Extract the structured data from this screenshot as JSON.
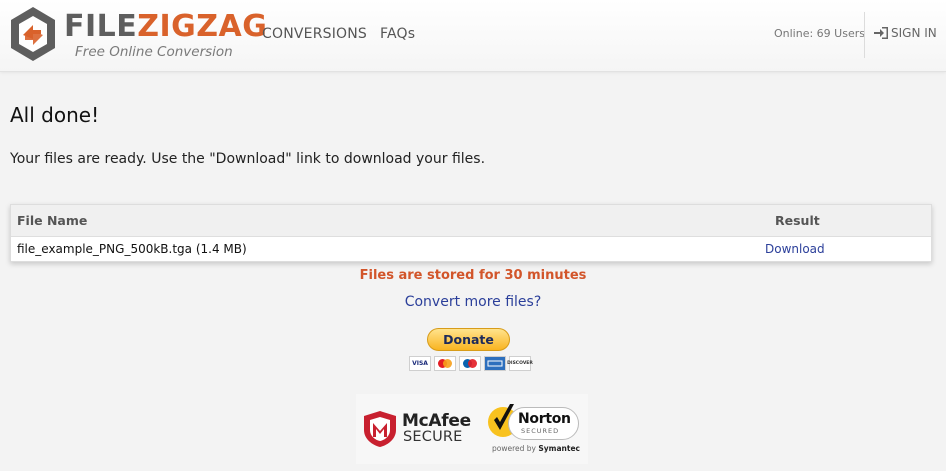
{
  "header": {
    "logo_file": "FILE",
    "logo_zig": "ZIGZAG",
    "tagline": "Free Online Conversion",
    "nav": {
      "conversions": "CONVERSIONS",
      "faqs": "FAQs"
    },
    "online": "Online: 69 Users",
    "signin": "SIGN IN"
  },
  "main": {
    "title": "All done!",
    "subtitle": "Your files are ready. Use the \"Download\" link to download your files."
  },
  "table": {
    "columns": [
      "File Name",
      "Result"
    ],
    "rows": [
      {
        "file": "file_example_PNG_500kB.tga (1.4 MB)",
        "result": "Download"
      }
    ]
  },
  "notices": {
    "stored": "Files are stored for 30 minutes",
    "convert_more": "Convert more files?"
  },
  "donate": {
    "label": "Donate",
    "cards": [
      "VISA",
      "mastercard",
      "maestro",
      "amex",
      "DISCOVER"
    ]
  },
  "badges": {
    "mcafee_brand": "McAfee",
    "mcafee_secure": "SECURE",
    "norton_brand": "Norton",
    "norton_secured": "SECURED",
    "powered_by": "powered by",
    "symantec": "Symantec"
  },
  "colors": {
    "accent": "#d9622b",
    "link": "#2b3f9a",
    "notice": "#d2552a"
  }
}
